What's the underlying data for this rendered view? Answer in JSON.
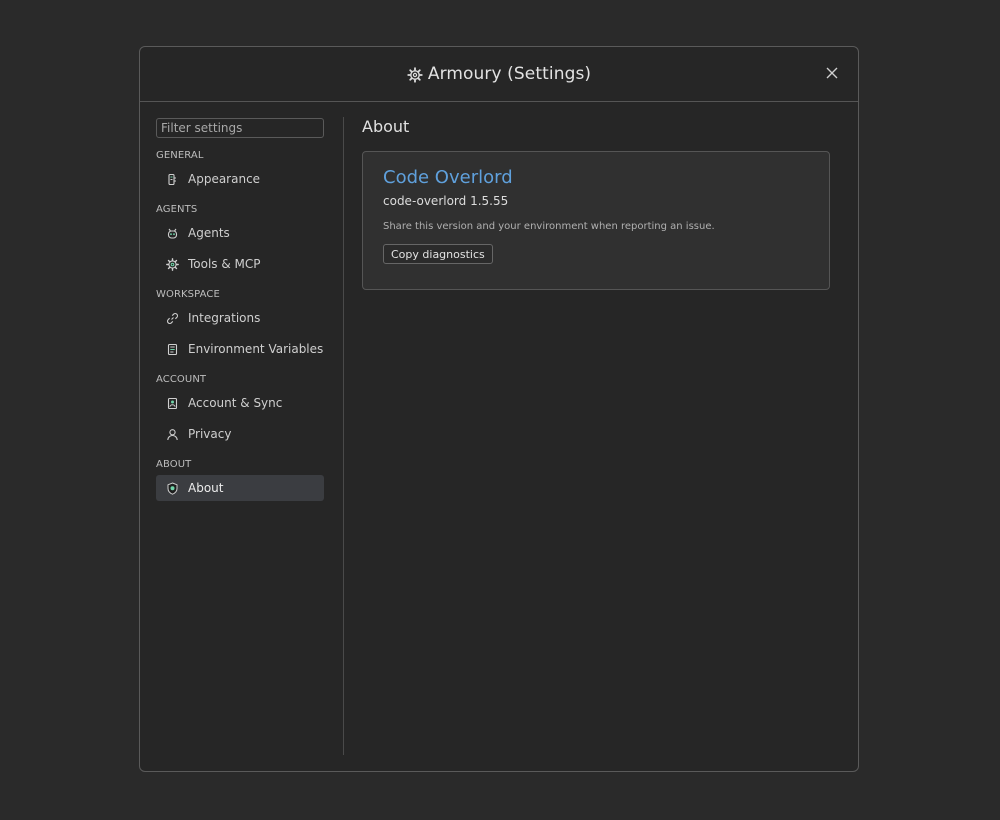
{
  "window": {
    "title": "Armoury (Settings)",
    "title_icon": "gear-icon",
    "close_icon": "close-icon"
  },
  "sidebar": {
    "filter_placeholder": "Filter settings",
    "filter_value": "",
    "sections": [
      {
        "header": "GENERAL",
        "items": [
          {
            "label": "Appearance",
            "icon": "palette-icon"
          }
        ]
      },
      {
        "header": "AGENTS",
        "items": [
          {
            "label": "Agents",
            "icon": "robot-icon"
          },
          {
            "label": "Tools & MCP",
            "icon": "gear-icon"
          }
        ]
      },
      {
        "header": "WORKSPACE",
        "items": [
          {
            "label": "Integrations",
            "icon": "link-icon"
          },
          {
            "label": "Environment Variables",
            "icon": "variables-icon"
          }
        ]
      },
      {
        "header": "ACCOUNT",
        "items": [
          {
            "label": "Account & Sync",
            "icon": "sync-icon"
          },
          {
            "label": "Privacy",
            "icon": "user-icon"
          }
        ]
      },
      {
        "header": "ABOUT",
        "items": [
          {
            "label": "About",
            "icon": "shield-icon",
            "active": true
          }
        ]
      }
    ]
  },
  "main": {
    "title": "About",
    "card": {
      "app_name": "Code Overlord",
      "version": "code-overlord 1.5.55",
      "note": "Share this version and your environment when reporting an issue.",
      "copy_button": "Copy diagnostics"
    }
  },
  "colors": {
    "background": "#2a2a2a",
    "dialog": "#262626",
    "accent_link": "#5fa0dc",
    "active_item": "#3b3d41",
    "icon_accent": "#6fd3a8"
  }
}
